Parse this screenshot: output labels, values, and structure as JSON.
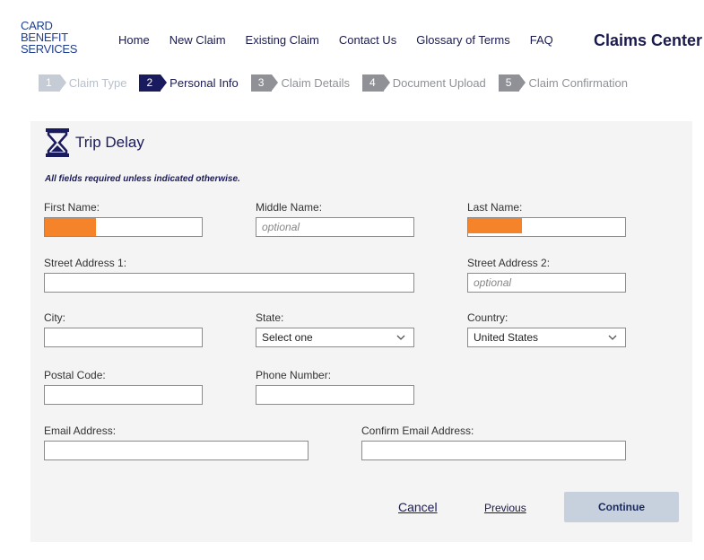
{
  "brand": {
    "line1": "CARD BENEFIT",
    "line2": "SERVICES"
  },
  "nav": [
    "Home",
    "New Claim",
    "Existing Claim",
    "Contact Us",
    "Glossary of Terms",
    "FAQ"
  ],
  "center_title": "Claims Center",
  "steps": [
    {
      "num": "1",
      "label": "Claim Type",
      "state": "done"
    },
    {
      "num": "2",
      "label": "Personal Info",
      "state": "active"
    },
    {
      "num": "3",
      "label": "Claim Details",
      "state": "todo"
    },
    {
      "num": "4",
      "label": "Document Upload",
      "state": "todo"
    },
    {
      "num": "5",
      "label": "Claim Confirmation",
      "state": "todo"
    }
  ],
  "form": {
    "title": "Trip Delay",
    "icon": "hourglass-icon",
    "required_note": "All fields required unless indicated otherwise.",
    "fields": {
      "first_name": {
        "label": "First Name:",
        "value": "",
        "redacted": true
      },
      "middle_name": {
        "label": "Middle Name:",
        "placeholder": "optional"
      },
      "last_name": {
        "label": "Last Name:",
        "value": "",
        "redacted": true
      },
      "street1": {
        "label": "Street Address 1:",
        "value": ""
      },
      "street2": {
        "label": "Street Address 2:",
        "placeholder": "optional"
      },
      "city": {
        "label": "City:",
        "value": ""
      },
      "state": {
        "label": "State:",
        "selected": "Select one"
      },
      "country": {
        "label": "Country:",
        "selected": "United States"
      },
      "postal": {
        "label": "Postal Code:",
        "value": ""
      },
      "phone": {
        "label": "Phone Number:",
        "value": ""
      },
      "email": {
        "label": "Email Address:",
        "value": ""
      },
      "email_confirm": {
        "label": "Confirm Email Address:",
        "value": ""
      }
    },
    "buttons": {
      "cancel": "Cancel",
      "previous": "Previous",
      "continue": "Continue"
    }
  },
  "colors": {
    "navy": "#1a1a5e",
    "redact": "#f5832a",
    "panel": "#f4f4f5",
    "continue_bg": "#c7d0dd"
  }
}
